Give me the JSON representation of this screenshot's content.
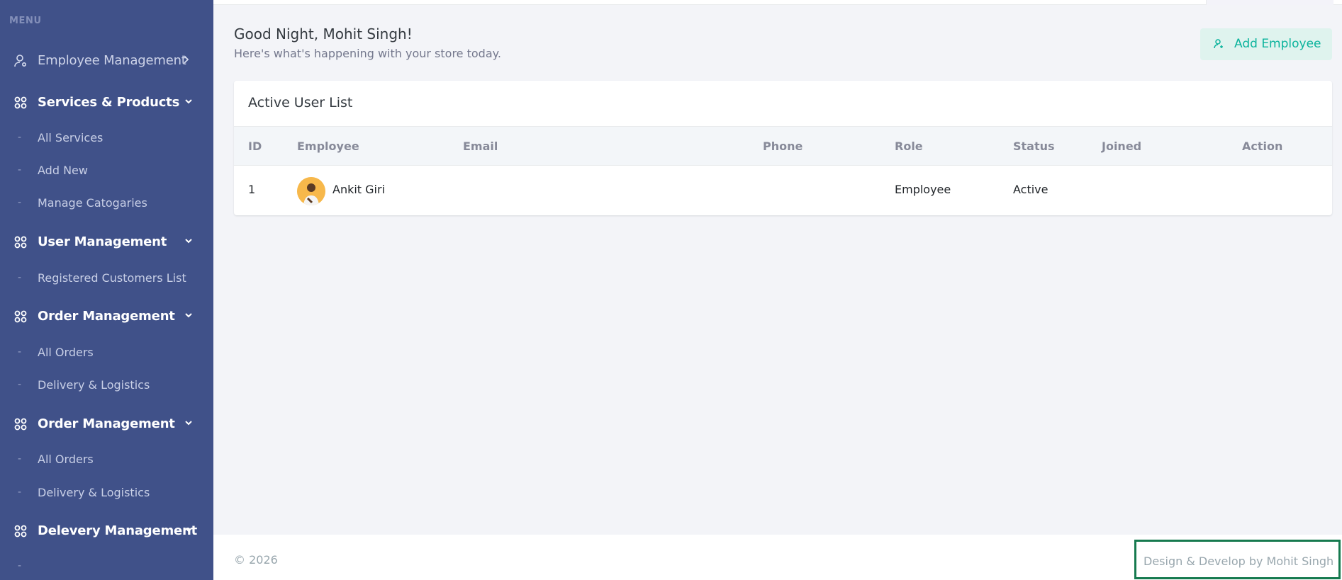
{
  "sidebar": {
    "menu_title": "MENU",
    "items": [
      {
        "label": "Employee Management",
        "icon": "user-settings-icon"
      },
      {
        "label": "Services & Products",
        "icon": "apps-grid-icon"
      },
      {
        "label": "All Services"
      },
      {
        "label": "Add New"
      },
      {
        "label": "Manage Catogaries"
      },
      {
        "label": "User Management",
        "icon": "apps-grid-icon"
      },
      {
        "label": "Registered Customers List"
      },
      {
        "label": "Order Management",
        "icon": "apps-grid-icon"
      },
      {
        "label": "All Orders"
      },
      {
        "label": "Delivery & Logistics"
      },
      {
        "label": "Order Management",
        "icon": "apps-grid-icon"
      },
      {
        "label": "All Orders"
      },
      {
        "label": "Delivery & Logistics"
      },
      {
        "label": "Delevery Management",
        "icon": "apps-grid-icon"
      }
    ]
  },
  "header": {
    "greeting": "Good Night, Mohit Singh!",
    "subtitle": "Here's what's happening with your store today.",
    "add_button": "Add Employee"
  },
  "card": {
    "title": "Active User List",
    "columns": [
      "ID",
      "Employee",
      "Email",
      "Phone",
      "Role",
      "Status",
      "Joined",
      "Action"
    ],
    "rows": [
      {
        "id": "1",
        "employee": "Ankit Giri",
        "email": "",
        "phone": "",
        "role": "Employee",
        "status": "Active",
        "joined": "",
        "action": ""
      }
    ]
  },
  "footer": {
    "copyright": "© 2026",
    "credit": "Design & Develop by Mohit Singh"
  },
  "colors": {
    "sidebar_bg": "#405189",
    "accent_green": "#0ab39c",
    "credit_border": "#167a4f"
  }
}
